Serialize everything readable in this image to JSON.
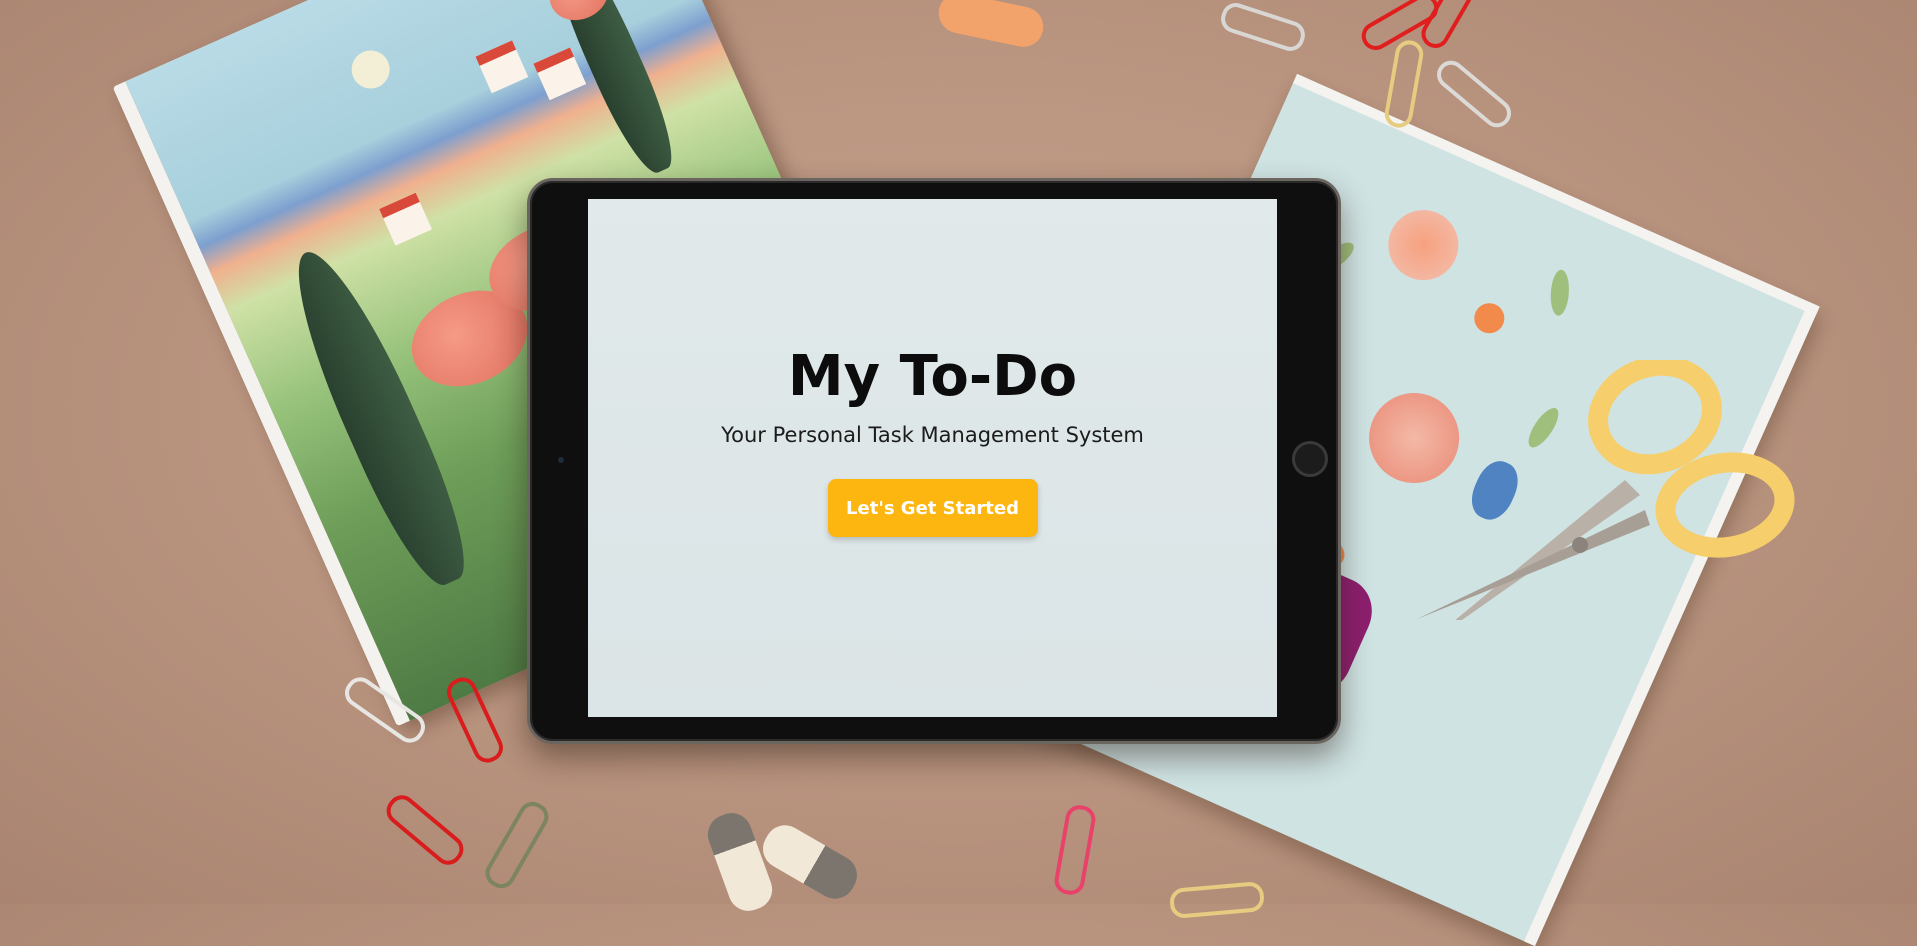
{
  "app": {
    "title": "My To-Do",
    "subtitle": "Your Personal Task Management System",
    "cta_label": "Let's Get Started"
  },
  "colors": {
    "background": "#b8937e",
    "screen": "#dbe4e6",
    "accent": "#fdb610",
    "title_text": "#0c0c0c"
  }
}
